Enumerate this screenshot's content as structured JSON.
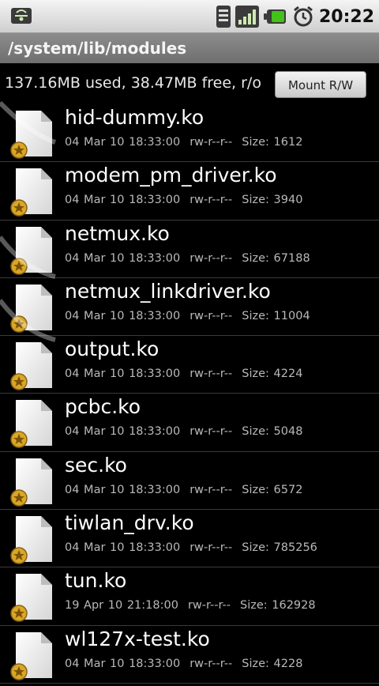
{
  "status_bar": {
    "time": "20:22",
    "icons": [
      "usb-icon",
      "wifi-icon",
      "signal-icon",
      "battery-icon",
      "alarm-icon"
    ]
  },
  "path": "/system/lib/modules",
  "storage_info": "137.16MB used, 38.47MB free, r/o",
  "mount_button": "Mount R/W",
  "files": [
    {
      "name": "hid-dummy.ko",
      "date": "04 Mar 10 18:33:00",
      "perms": "rw-r--r--",
      "size": "Size: 1612"
    },
    {
      "name": "modem_pm_driver.ko",
      "date": "04 Mar 10 18:33:00",
      "perms": "rw-r--r--",
      "size": "Size: 3940"
    },
    {
      "name": "netmux.ko",
      "date": "04 Mar 10 18:33:00",
      "perms": "rw-r--r--",
      "size": "Size: 67188"
    },
    {
      "name": "netmux_linkdriver.ko",
      "date": "04 Mar 10 18:33:00",
      "perms": "rw-r--r--",
      "size": "Size: 11004"
    },
    {
      "name": "output.ko",
      "date": "04 Mar 10 18:33:00",
      "perms": "rw-r--r--",
      "size": "Size: 4224"
    },
    {
      "name": "pcbc.ko",
      "date": "04 Mar 10 18:33:00",
      "perms": "rw-r--r--",
      "size": "Size: 5048"
    },
    {
      "name": "sec.ko",
      "date": "04 Mar 10 18:33:00",
      "perms": "rw-r--r--",
      "size": "Size: 6572"
    },
    {
      "name": "tiwlan_drv.ko",
      "date": "04 Mar 10 18:33:00",
      "perms": "rw-r--r--",
      "size": "Size: 785256"
    },
    {
      "name": "tun.ko",
      "date": "19 Apr 10 21:18:00",
      "perms": "rw-r--r--",
      "size": "Size: 162928"
    },
    {
      "name": "wl127x-test.ko",
      "date": "04 Mar 10 18:33:00",
      "perms": "rw-r--r--",
      "size": "Size: 4228"
    }
  ],
  "colors": {
    "background": "#000000",
    "path_bar": "#7a7a7a",
    "badge": "#d9a626",
    "battery": "#43c21a"
  }
}
